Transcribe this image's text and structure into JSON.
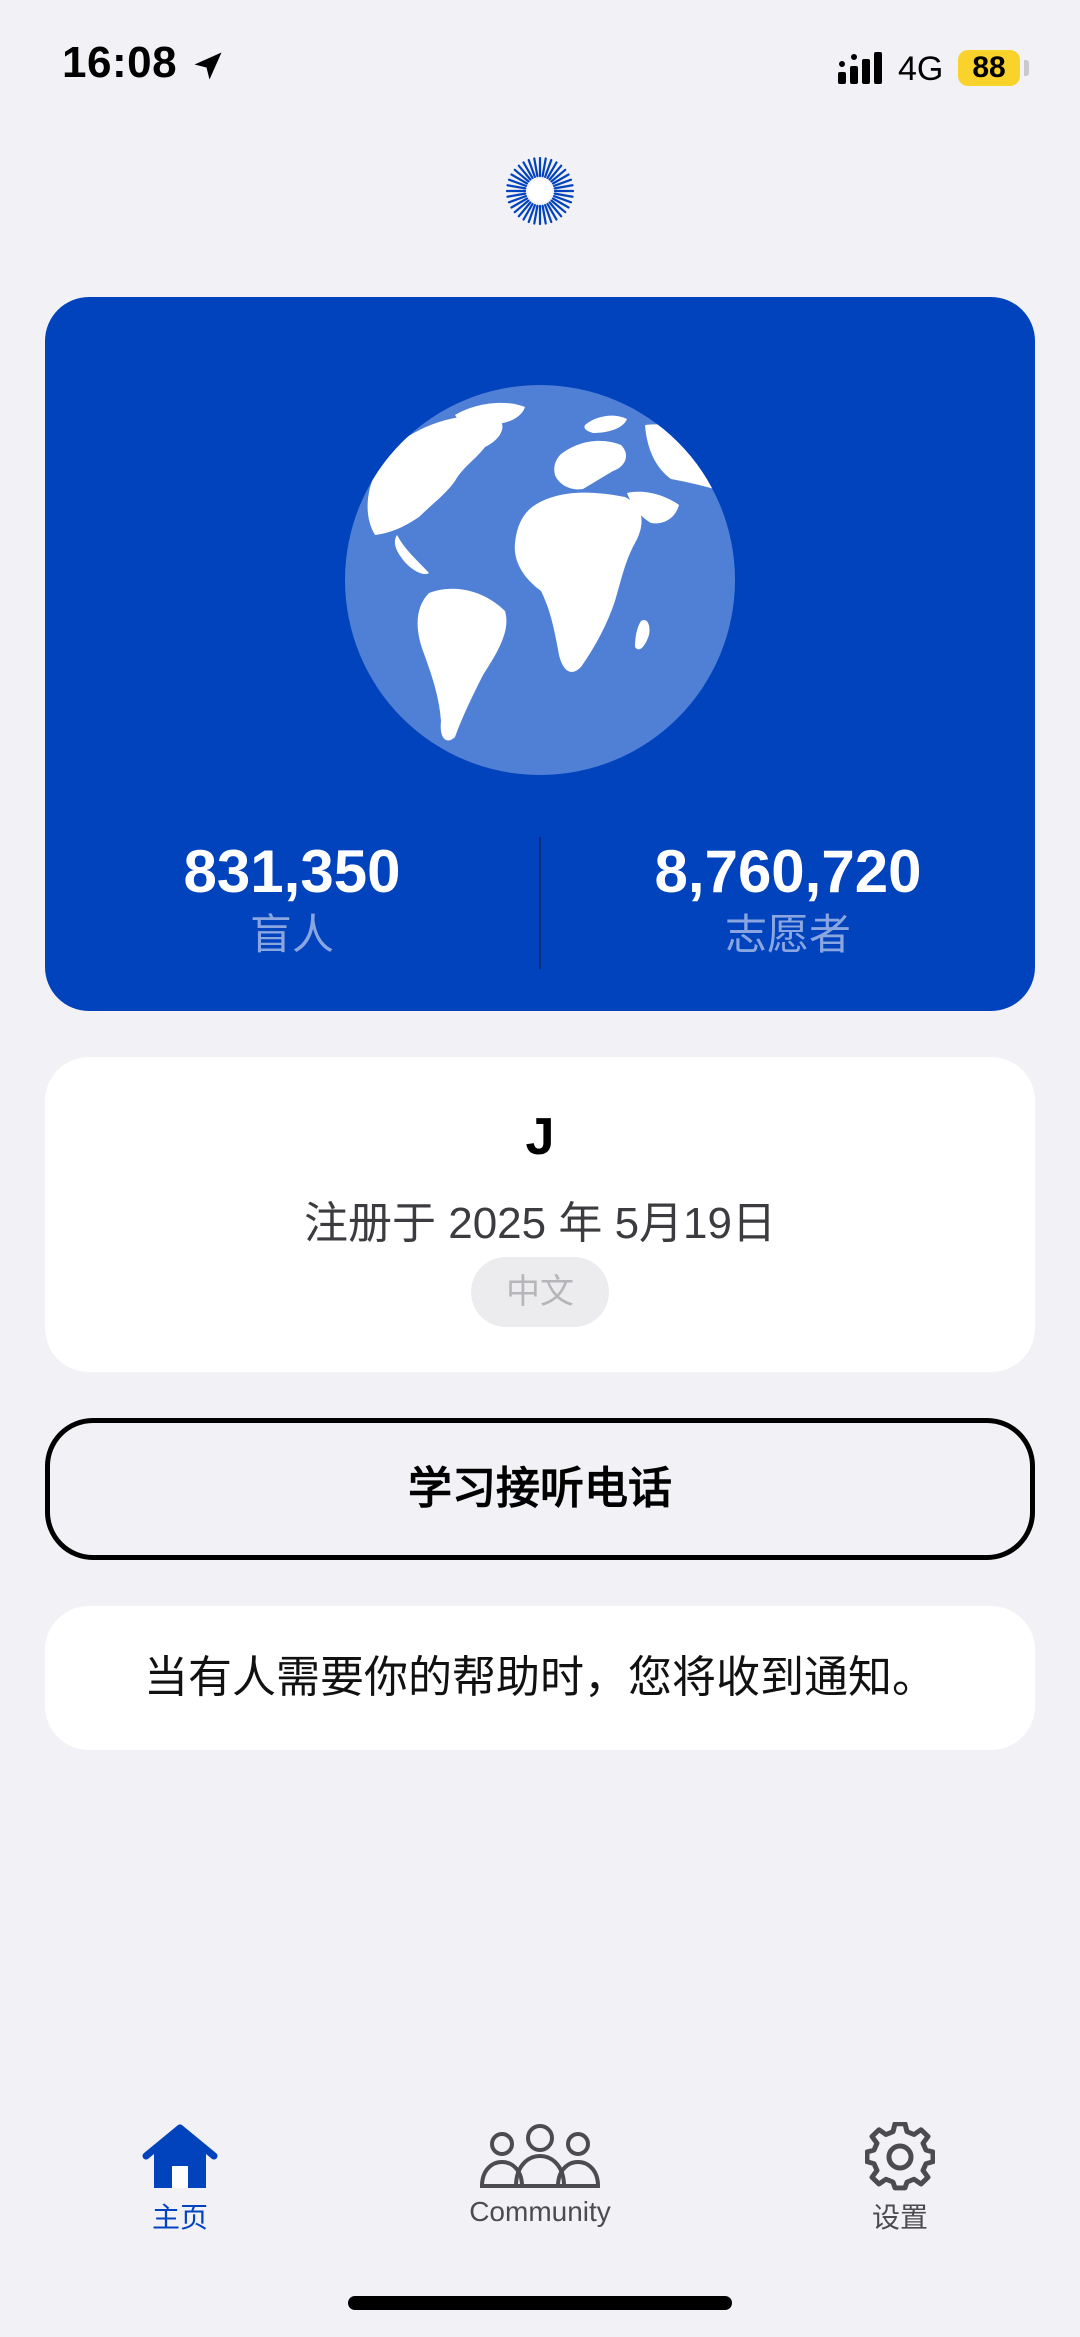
{
  "status_bar": {
    "time": "16:08",
    "network": "4G",
    "battery": "88"
  },
  "colors": {
    "brand_blue": "#0142bd",
    "background": "#f2f2f6",
    "battery_yellow": "#f9d32b"
  },
  "stats": {
    "blind_count": "831,350",
    "blind_label": "盲人",
    "volunteer_count": "8,760,720",
    "volunteer_label": "志愿者"
  },
  "profile": {
    "name": "J",
    "registered": "注册于 2025 年 5月19日",
    "language": "中文"
  },
  "learn_button": {
    "label": "学习接听电话"
  },
  "notice": {
    "text": "当有人需要你的帮助时，您将收到通知。"
  },
  "tabs": [
    {
      "label": "主页",
      "icon": "home-icon",
      "selected": true
    },
    {
      "label": "Community",
      "icon": "community-icon",
      "selected": false
    },
    {
      "label": "设置",
      "icon": "gear-icon",
      "selected": false
    }
  ]
}
